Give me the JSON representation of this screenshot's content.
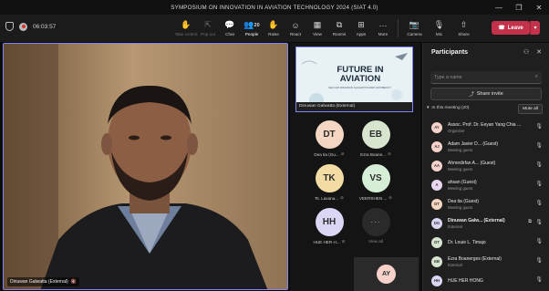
{
  "window": {
    "title": "SYMPOSIUM ON INNOVATION IN AVIATION TECHNOLOGY 2024 (SIAT 4.0)",
    "controls": [
      "—",
      "❐",
      "✕"
    ]
  },
  "toolbar": {
    "timer": "06:03:57",
    "items": [
      {
        "label": "Take control",
        "icon": "take-control-icon",
        "glyph": "✋",
        "dim": true
      },
      {
        "label": "Pop out",
        "icon": "pop-out-icon",
        "glyph": "⇱",
        "dim": true
      },
      {
        "label": "Chat",
        "icon": "chat-icon",
        "glyph": "💬",
        "dim": false
      },
      {
        "label": "People",
        "icon": "people-icon",
        "glyph": "👥",
        "dim": false,
        "count": "20"
      },
      {
        "label": "Raise",
        "icon": "raise-hand-icon",
        "glyph": "✋",
        "dim": false
      },
      {
        "label": "React",
        "icon": "react-icon",
        "glyph": "☺",
        "dim": false
      },
      {
        "label": "View",
        "icon": "view-icon",
        "glyph": "▦",
        "dim": false
      },
      {
        "label": "Rooms",
        "icon": "rooms-icon",
        "glyph": "⧉",
        "dim": false
      },
      {
        "label": "Apps",
        "icon": "apps-icon",
        "glyph": "⊞",
        "dim": false
      },
      {
        "label": "More",
        "icon": "more-icon",
        "glyph": "···",
        "dim": false
      }
    ],
    "device_items": [
      {
        "label": "Camera",
        "icon": "camera-icon",
        "glyph": "📷"
      },
      {
        "label": "Mic",
        "icon": "mic-off-icon",
        "glyph": "🎙"
      },
      {
        "label": "Share",
        "icon": "share-icon",
        "glyph": "⇧"
      }
    ],
    "leave_label": "Leave"
  },
  "main_video": {
    "name": "Dinuwan Galwatta (External)"
  },
  "content_share": {
    "title": "FUTURE IN AVIATION",
    "subtitle": "CEO AIR DINUWAN GALWATTA DIRK DROBECKY",
    "presenter": "Dinuwan Galwatta (External)"
  },
  "tiles": [
    {
      "initials": "DT",
      "name": "Dea tia (Gu...",
      "color": "#f3d7c2"
    },
    {
      "initials": "EB",
      "name": "Ezra Boane...",
      "color": "#d7e5cf"
    },
    {
      "initials": "TK",
      "name": "Ts. Laxana...",
      "color": "#f2dca3"
    },
    {
      "initials": "VS",
      "name": "VEERSHEN ...",
      "color": "#d6eed6"
    },
    {
      "initials": "HH",
      "name": "HUE HER H...",
      "color": "#dcd6f5"
    },
    {
      "initials": "···",
      "name": "View all",
      "color": "#2a2a2a"
    }
  ],
  "bottom_tile": {
    "initials": "AY",
    "color": "#f6d2cb"
  },
  "panel": {
    "title": "Participants",
    "search_placeholder": "Type a name",
    "share_invite": "Share invite",
    "in_meeting": "In this meeting (20)",
    "mute_all": "Mute all",
    "participants": [
      {
        "initials": "AY",
        "name": "Assoc. Prof. Dr. Eeyan Yang Chia ...",
        "role": "Organizer",
        "color": "#f6d2cb",
        "bold": false,
        "sharing": false
      },
      {
        "initials": "AJ",
        "name": "Adam Javier D...  (Guest)",
        "role": "Meeting guest",
        "color": "#f6d2cb",
        "bold": false,
        "sharing": false
      },
      {
        "initials": "AA",
        "name": "Ahmedirfan A...  (Guest)",
        "role": "Meeting guest",
        "color": "#f6d2cb",
        "bold": false,
        "sharing": false
      },
      {
        "initials": "A",
        "name": "ahsan (Guest)",
        "role": "Meeting guest",
        "color": "#e8d7ef",
        "bold": false,
        "sharing": false
      },
      {
        "initials": "DT",
        "name": "Dea tia (Guest)",
        "role": "Meeting guest",
        "color": "#f3d7c2",
        "bold": false,
        "sharing": false
      },
      {
        "initials": "DG",
        "name": "Dinuwan Galw...  (External)",
        "role": "External",
        "color": "#dcd6f5",
        "bold": true,
        "sharing": true
      },
      {
        "initials": "DT",
        "name": "Dr. Louie L. Timajo",
        "role": "",
        "color": "#d7e5cf",
        "bold": false,
        "sharing": false
      },
      {
        "initials": "EB",
        "name": "Ezra Boanerges (External)",
        "role": "External",
        "color": "#d7e5cf",
        "bold": false,
        "sharing": false
      },
      {
        "initials": "HH",
        "name": "HUE HER HONG",
        "role": "",
        "color": "#dcd6f5",
        "bold": false,
        "sharing": false
      }
    ]
  }
}
